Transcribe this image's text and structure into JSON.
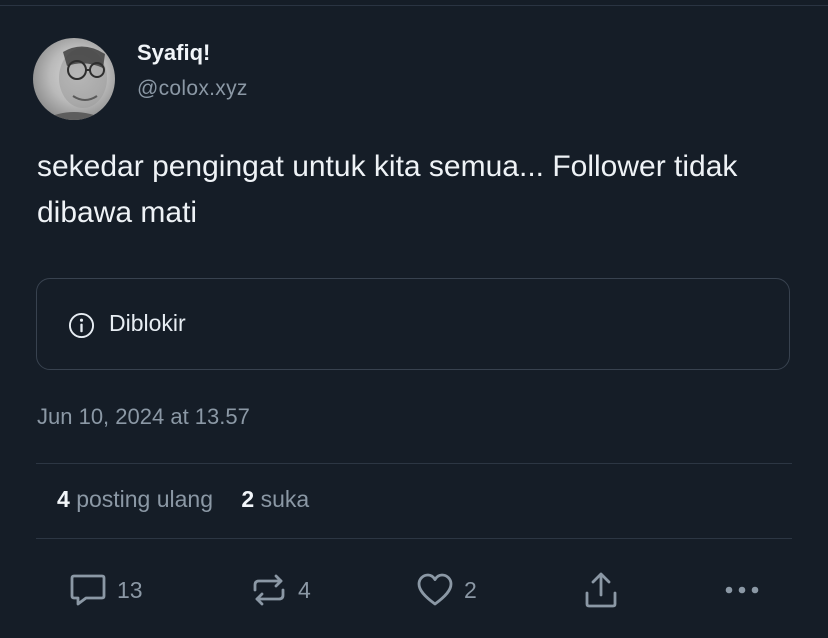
{
  "author": {
    "name": "Syafiq!",
    "handle": "@colox.xyz"
  },
  "post": {
    "text": "sekedar pengingat untuk kita semua... Follower tidak dibawa mati",
    "notice_label": "Diblokir",
    "timestamp": "Jun 10, 2024 at 13.57"
  },
  "stats": {
    "reposts_count": "4",
    "reposts_label": "posting ulang",
    "likes_count": "2",
    "likes_label": "suka"
  },
  "actions": {
    "replies": "13",
    "reposts": "4",
    "likes": "2"
  },
  "icons": [
    "info-icon",
    "reply-icon",
    "repost-icon",
    "heart-icon",
    "share-icon",
    "more-icon"
  ],
  "colors": {
    "background": "#151d27",
    "text_primary": "#e7edf3",
    "text_secondary": "#8b98a5",
    "border": "#38424f"
  }
}
